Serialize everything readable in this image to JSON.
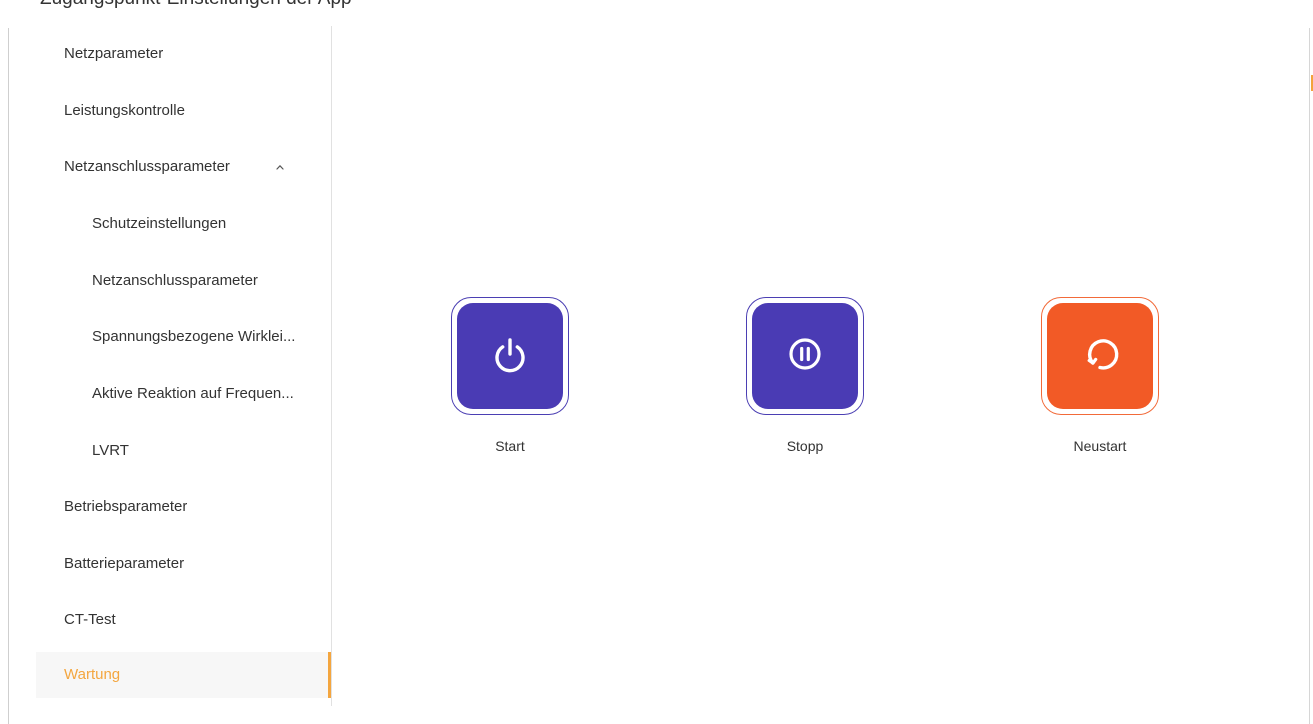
{
  "page": {
    "title_partial": "Zugangspunkt-Einstellungen der App"
  },
  "sidebar": {
    "items": [
      {
        "label": "Netzparameter",
        "active": false
      },
      {
        "label": "Leistungskontrolle",
        "active": false
      },
      {
        "label": "Netzanschlussparameter",
        "expanded": true,
        "icon": "chevron-up-icon"
      },
      {
        "label": "Schutzeinstellungen",
        "active": false
      },
      {
        "label": "Netzanschlussparameter",
        "active": false
      },
      {
        "label": "Spannungsbezogene Wirklei...",
        "active": false
      },
      {
        "label": "Aktive Reaktion auf Frequen...",
        "active": false
      },
      {
        "label": "LVRT",
        "active": false
      },
      {
        "label": "Betriebsparameter",
        "active": false
      },
      {
        "label": "Batterieparameter",
        "active": false
      },
      {
        "label": "CT-Test",
        "active": false
      },
      {
        "label": "Wartung",
        "active": true
      }
    ]
  },
  "actions": [
    {
      "label": "Start",
      "icon": "power-icon",
      "color": "#4A3BB4"
    },
    {
      "label": "Stopp",
      "icon": "pause-icon",
      "color": "#4A3BB4"
    },
    {
      "label": "Neustart",
      "icon": "restart-icon",
      "color": "#F25A26"
    }
  ],
  "colors": {
    "active_accent": "#F4A63F",
    "primary": "#4A3BB4",
    "warning": "#F25A26"
  }
}
